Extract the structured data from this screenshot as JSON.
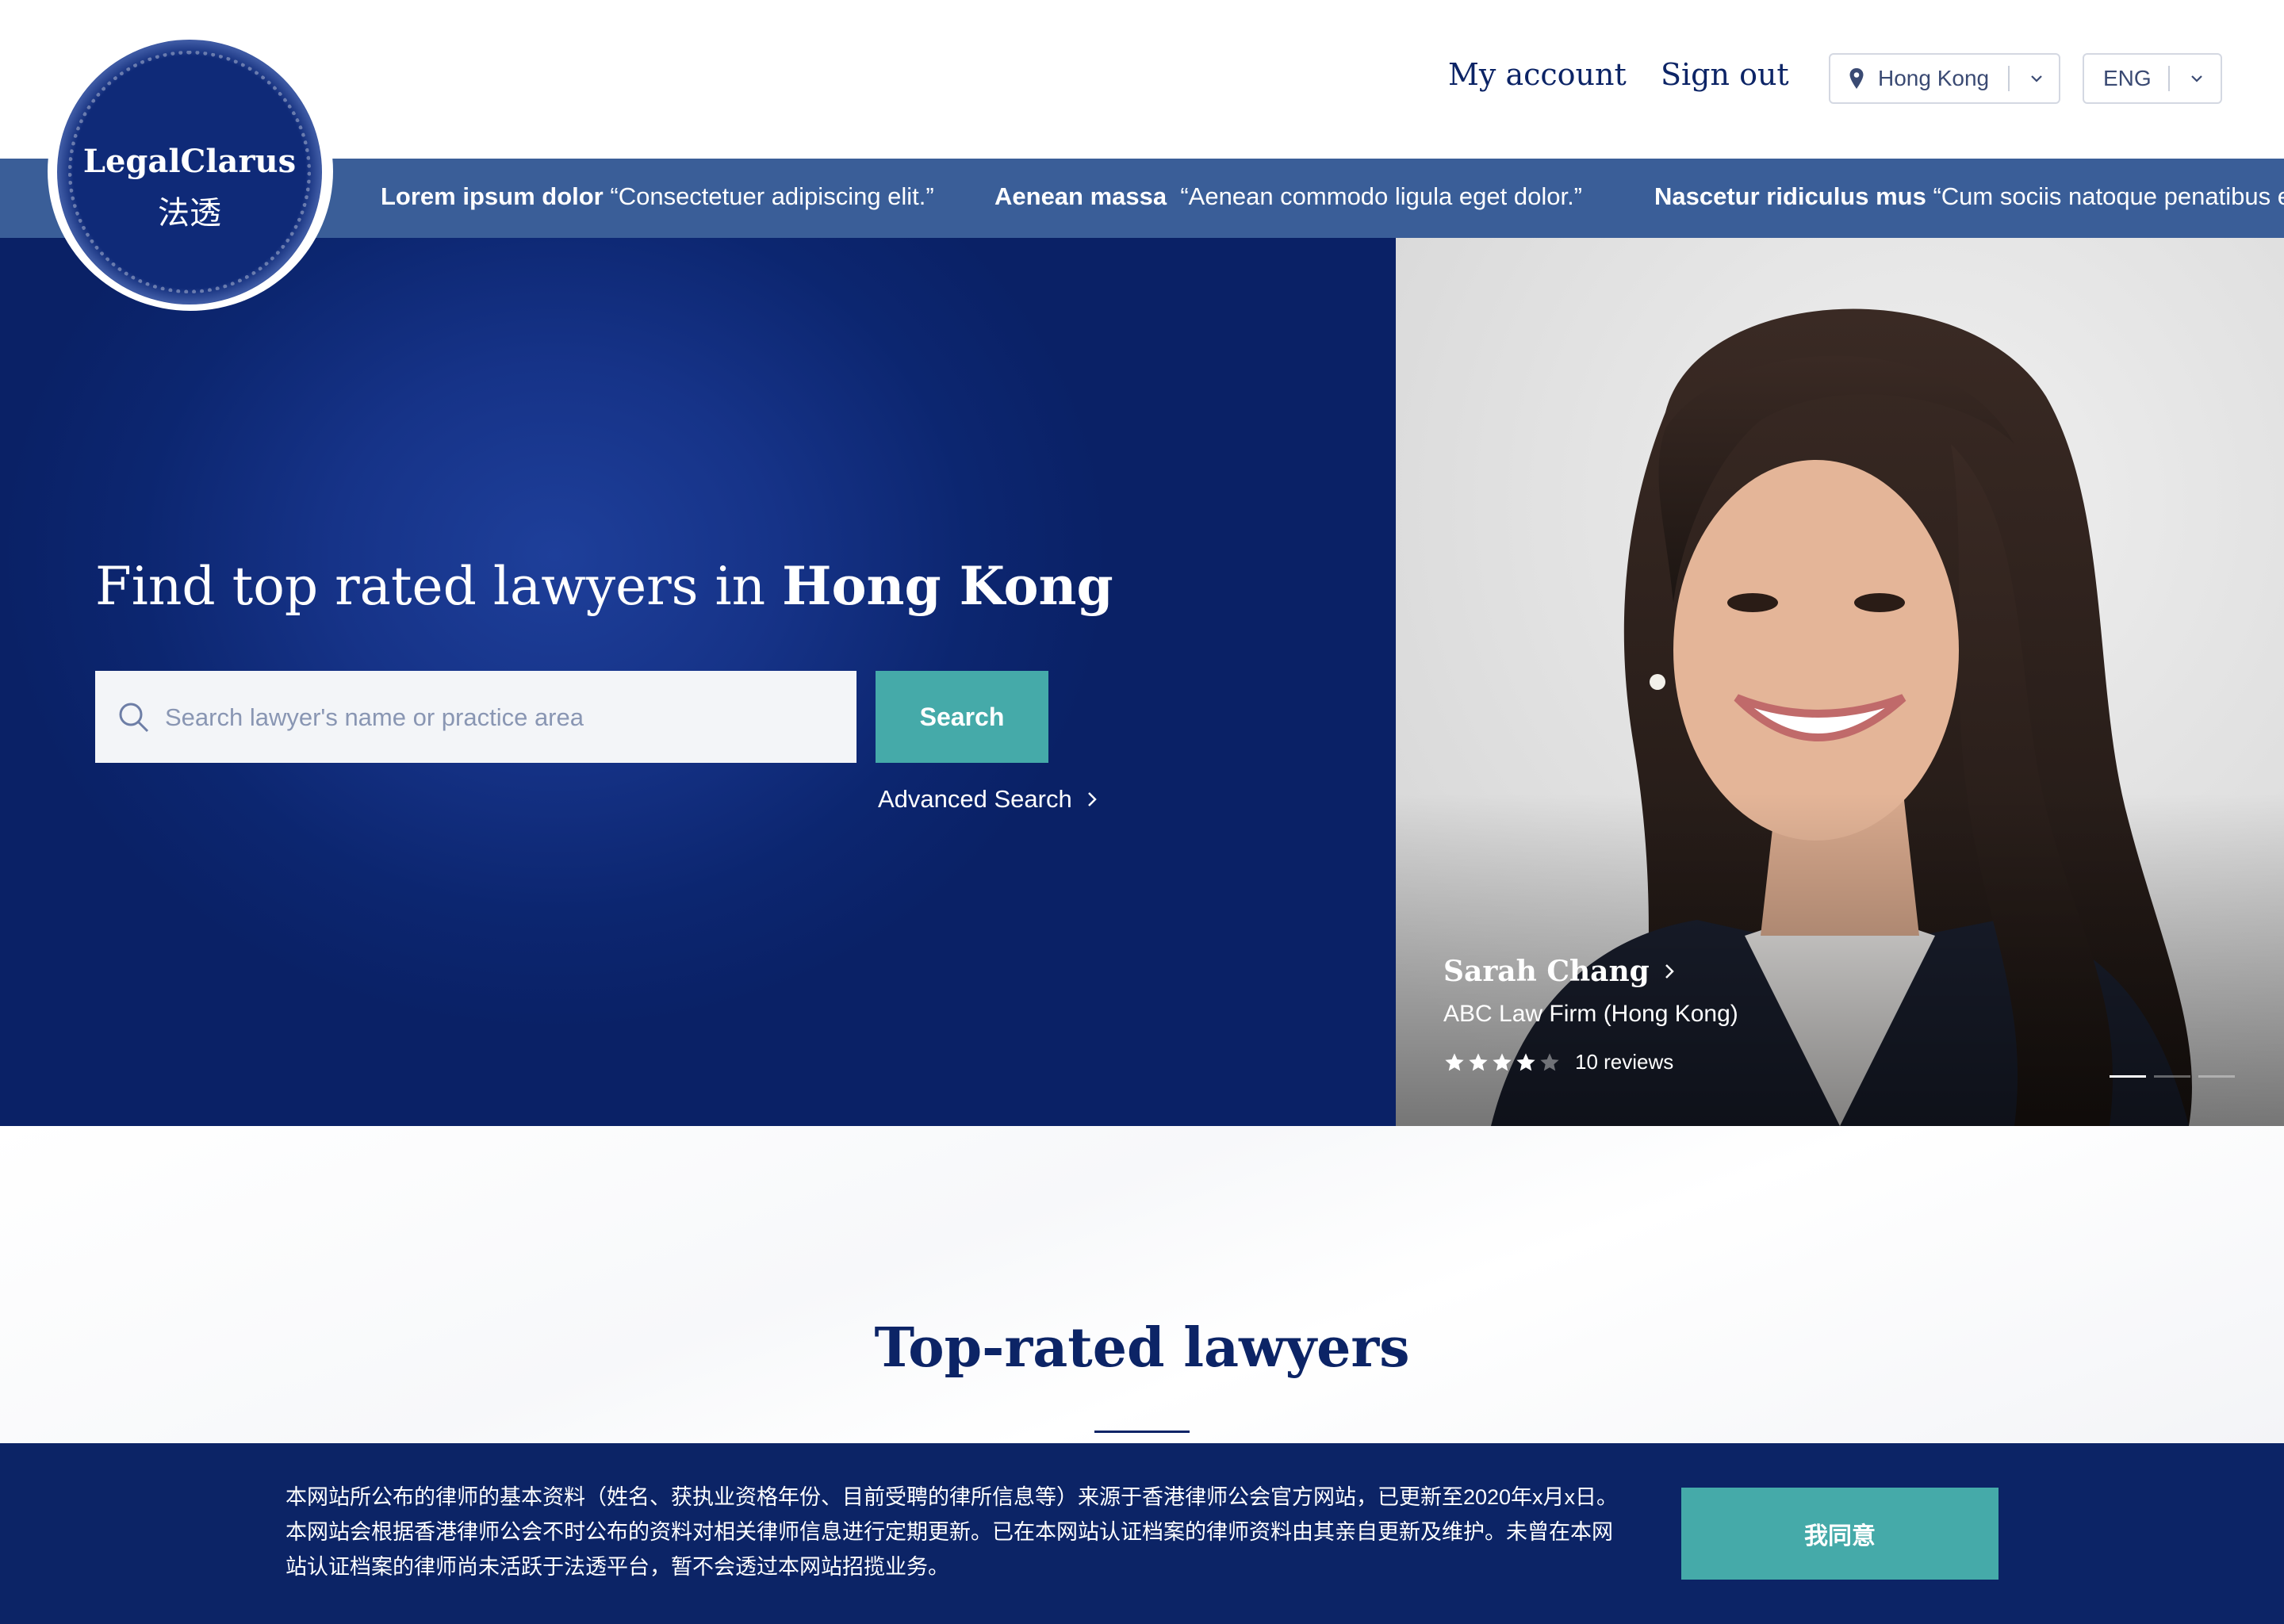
{
  "logo": {
    "name_en": "LegalClarus",
    "name_cn": "法透"
  },
  "header": {
    "my_account": "My account",
    "sign_out": "Sign out",
    "region": "Hong Kong",
    "language": "ENG"
  },
  "ticker": [
    {
      "bold": "Lorem ipsum dolor",
      "quote": "“Consectetuer adipiscing elit.”"
    },
    {
      "bold": "Aenean massa",
      "quote": "“Aenean commodo ligula eget dolor.”"
    },
    {
      "bold": "Nascetur ridiculus mus",
      "quote": "“Cum sociis natoque penatibus et m"
    }
  ],
  "hero": {
    "title_prefix": "Find top rated lawyers in ",
    "title_location": "Hong Kong",
    "search_placeholder": "Search lawyer's name or practice area",
    "search_button": "Search",
    "advanced_search": "Advanced Search"
  },
  "featured": {
    "name": "Sarah Chang",
    "firm": "ABC Law Firm (Hong Kong)",
    "rating": 4,
    "rating_max": 5,
    "reviews": "10 reviews",
    "slides_total": 3,
    "slide_active": 1
  },
  "section": {
    "title": "Top-rated lawyers"
  },
  "banner": {
    "text": "本网站所公布的律师的基本资料（姓名、获执业资格年份、目前受聘的律所信息等）来源于香港律师公会官方网站，已更新至2020年x月x日。本网站会根据香港律师公会不时公布的资料对相关律师信息进行定期更新。已在本网站认证档案的律师资料由其亲自更新及维护。未曾在本网站认证档案的律师尚未活跃于法透平台，暂不会透过本网站招揽业务。",
    "agree": "我同意"
  },
  "colors": {
    "navy": "#0c2466",
    "teal": "#45aaa9",
    "ticker": "#3a5e98"
  }
}
